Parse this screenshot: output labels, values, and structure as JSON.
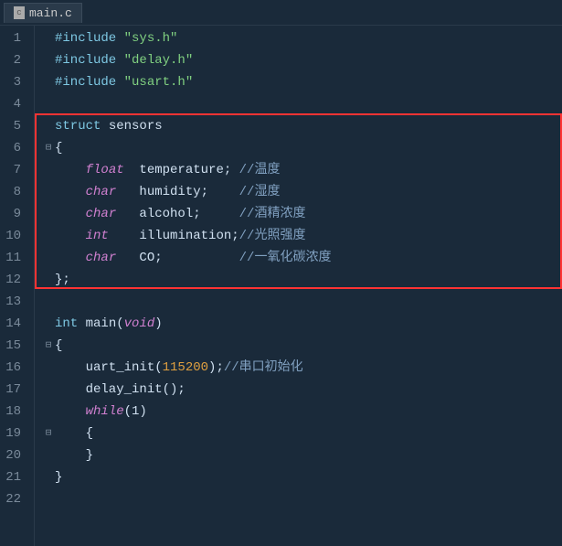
{
  "tab": {
    "label": "main.c"
  },
  "lines": [
    {
      "num": 1,
      "fold": "",
      "code": "<span class='kw-include'>#include</span> <span class='str'>\"sys.h\"</span>"
    },
    {
      "num": 2,
      "fold": "",
      "code": "<span class='kw-include'>#include</span> <span class='str'>\"delay.h\"</span>"
    },
    {
      "num": 3,
      "fold": "",
      "code": "<span class='kw-include'>#include</span> <span class='str'>\"usart.h\"</span>"
    },
    {
      "num": 4,
      "fold": "",
      "code": ""
    },
    {
      "num": 5,
      "fold": "",
      "code": "<span class='kw-struct'>struct</span> sensors"
    },
    {
      "num": 6,
      "fold": "⊟",
      "code": "{"
    },
    {
      "num": 7,
      "fold": "",
      "code": "    <span class='kw-type'>float</span>  temperature; <span class='comment-zh'>//温度</span>"
    },
    {
      "num": 8,
      "fold": "",
      "code": "    <span class='kw-type'>char</span>   humidity;    <span class='comment-zh'>//湿度</span>"
    },
    {
      "num": 9,
      "fold": "",
      "code": "    <span class='kw-type'>char</span>   alcohol;     <span class='comment-zh'>//酒精浓度</span>"
    },
    {
      "num": 10,
      "fold": "",
      "code": "    <span class='kw-type'>int</span>    illumination;<span class='comment-zh'>//光照强度</span>"
    },
    {
      "num": 11,
      "fold": "",
      "code": "    <span class='kw-type'>char</span>   CO;          <span class='comment-zh'>//一氧化碳浓度</span>"
    },
    {
      "num": 12,
      "fold": "",
      "code": "};"
    },
    {
      "num": 13,
      "fold": "",
      "code": ""
    },
    {
      "num": 14,
      "fold": "",
      "code": "<span class='kw-int'>int</span> main(<span class='kw-void'>void</span>)"
    },
    {
      "num": 15,
      "fold": "⊟",
      "code": "{"
    },
    {
      "num": 16,
      "fold": "",
      "code": "    uart_init(<span class='num'>115200</span>);<span class='comment-zh'>//串口初始化</span>"
    },
    {
      "num": 17,
      "fold": "",
      "code": "    delay_init();"
    },
    {
      "num": 18,
      "fold": "",
      "code": "    <span class='kw-while'>while</span>(1)"
    },
    {
      "num": 19,
      "fold": "⊟",
      "code": "    {"
    },
    {
      "num": 20,
      "fold": "",
      "code": "    }"
    },
    {
      "num": 21,
      "fold": "",
      "code": "}"
    },
    {
      "num": 22,
      "fold": "",
      "code": ""
    }
  ]
}
